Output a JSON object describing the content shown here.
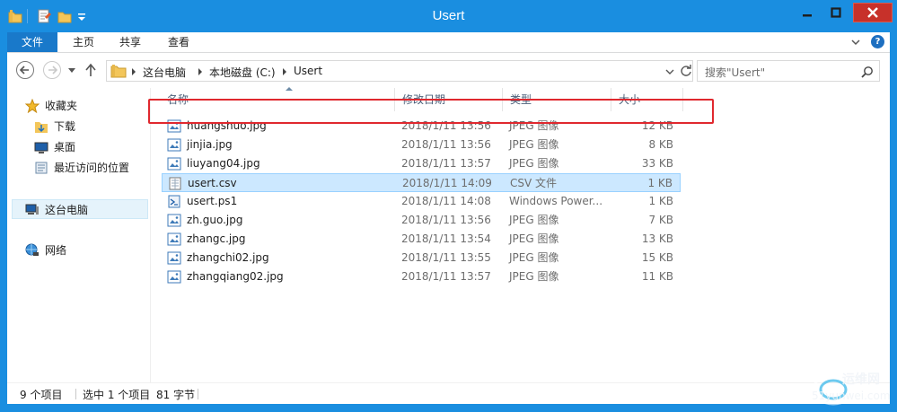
{
  "window": {
    "title": "Usert"
  },
  "ribbon": {
    "tabs": [
      {
        "label": "文件"
      },
      {
        "label": "主页"
      },
      {
        "label": "共享"
      },
      {
        "label": "查看"
      }
    ],
    "help": "?"
  },
  "address": {
    "crumbs": [
      "这台电脑",
      "本地磁盘 (C:)",
      "Usert"
    ],
    "search_placeholder": "搜索\"Usert\""
  },
  "nav": {
    "favorites": "收藏夹",
    "downloads": "下载",
    "desktop": "桌面",
    "recent": "最近访问的位置",
    "this_pc": "这台电脑",
    "network": "网络"
  },
  "columns": {
    "name": "名称",
    "date": "修改日期",
    "type": "类型",
    "size": "大小"
  },
  "files": [
    {
      "name": "huangshuo.jpg",
      "date": "2018/1/11 13:56",
      "type": "JPEG 图像",
      "size": "12 KB",
      "icon": "image-file-icon"
    },
    {
      "name": "jinjia.jpg",
      "date": "2018/1/11 13:56",
      "type": "JPEG 图像",
      "size": "8 KB",
      "icon": "image-file-icon"
    },
    {
      "name": "liuyang04.jpg",
      "date": "2018/1/11 13:57",
      "type": "JPEG 图像",
      "size": "33 KB",
      "icon": "image-file-icon"
    },
    {
      "name": "usert.csv",
      "date": "2018/1/11 14:09",
      "type": "CSV 文件",
      "size": "1 KB",
      "icon": "csv-file-icon"
    },
    {
      "name": "usert.ps1",
      "date": "2018/1/11 14:08",
      "type": "Windows Power...",
      "size": "1 KB",
      "icon": "powershell-file-icon"
    },
    {
      "name": "zh.guo.jpg",
      "date": "2018/1/11 13:56",
      "type": "JPEG 图像",
      "size": "7 KB",
      "icon": "image-file-icon"
    },
    {
      "name": "zhangc.jpg",
      "date": "2018/1/11 13:54",
      "type": "JPEG 图像",
      "size": "13 KB",
      "icon": "image-file-icon"
    },
    {
      "name": "zhangchi02.jpg",
      "date": "2018/1/11 13:55",
      "type": "JPEG 图像",
      "size": "15 KB",
      "icon": "image-file-icon"
    },
    {
      "name": "zhangqiang02.jpg",
      "date": "2018/1/11 13:57",
      "type": "JPEG 图像",
      "size": "11 KB",
      "icon": "image-file-icon"
    }
  ],
  "status": {
    "count": "9 个项目",
    "selected": "选中 1 个项目",
    "size": "81 字节"
  },
  "watermark": {
    "line1": "运维网",
    "line2": "51yunwei.com"
  },
  "colors": {
    "titlebar": "#1a8ee0",
    "file_tab": "#1979ca",
    "selection": "#cce8ff",
    "highlight": "#e0282e"
  }
}
